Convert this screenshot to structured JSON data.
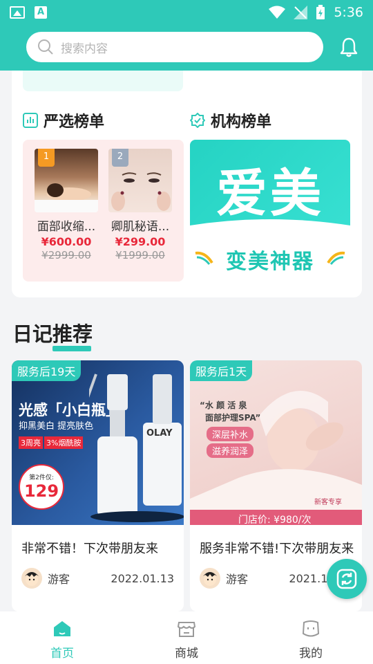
{
  "status_bar": {
    "time": "5:36"
  },
  "search": {
    "placeholder": "搜索内容"
  },
  "sections": {
    "strict_list": {
      "title": "严选榜单"
    },
    "org_list": {
      "title": "机构榜单"
    }
  },
  "products": [
    {
      "rank": "1",
      "name": "面部收缩...",
      "price": "¥600.00",
      "old_price": "¥2999.00"
    },
    {
      "rank": "2",
      "name": "卿肌秘语...",
      "price": "¥299.00",
      "old_price": "¥1999.00"
    }
  ],
  "banner": {
    "big_text": "爱美",
    "sub_text": "变美神器"
  },
  "diary": {
    "title": "日记推荐",
    "items": [
      {
        "service_badge": "服务后19天",
        "ad_headline": "光感「小白瓶」",
        "ad_sub": "抑黑美白 提亮肤色",
        "ad_tag1": "3周亮",
        "ad_tag2": "3%烟酰胺",
        "ad_price_label": "第2件仅:",
        "ad_price": "129",
        "ad_brand": "OLAY",
        "text": "非常不错！下次带朋友来",
        "user": "游客",
        "date": "2022.01.13"
      },
      {
        "service_badge": "服务后1天",
        "ad_headline": "“水 颜 活 泉",
        "ad_sub": "面部护理SPA”",
        "ad_tag1": "深层补水",
        "ad_tag2": "滋养润泽",
        "ad_store_price": "门店价: ¥980/次",
        "ad_new": "新客专享",
        "text": "服务非常不错!下次带朋友来",
        "user": "游客",
        "date": "2021.12.25"
      }
    ]
  },
  "tabs": [
    {
      "label": "首页",
      "icon": "home-icon",
      "active": true
    },
    {
      "label": "商城",
      "icon": "shop-icon",
      "active": false
    },
    {
      "label": "我的",
      "icon": "profile-icon",
      "active": false
    }
  ],
  "colors": {
    "accent": "#2ec9b8",
    "price_red": "#e8283a"
  }
}
